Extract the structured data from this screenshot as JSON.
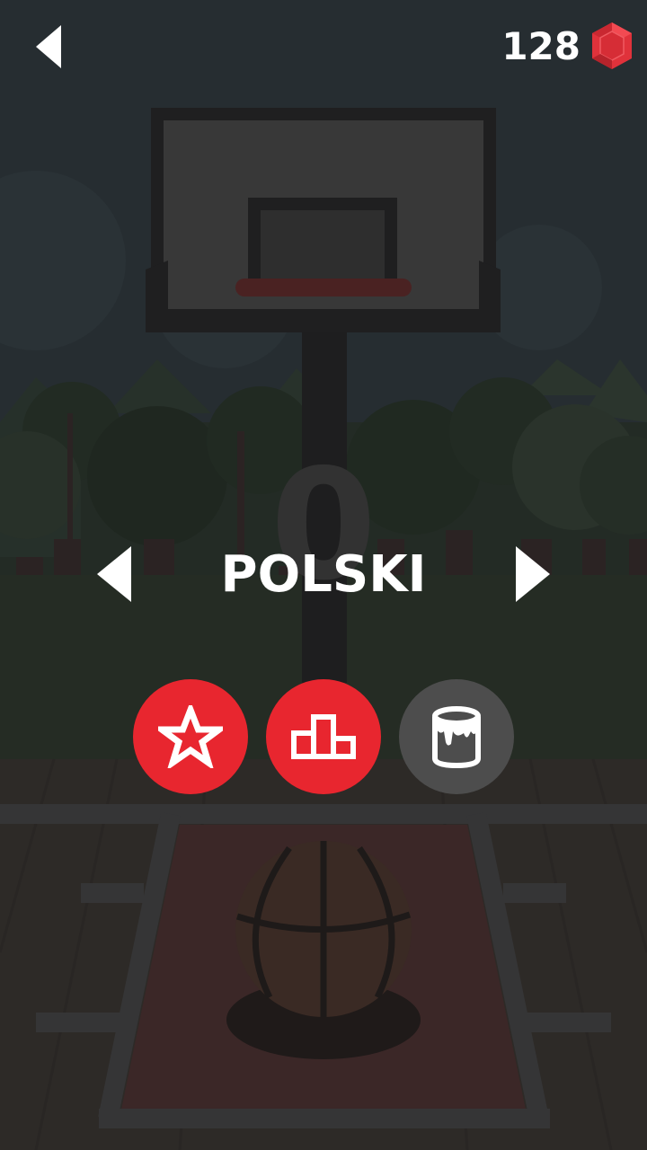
{
  "header": {
    "back_icon": "back-arrow-icon",
    "gem_count": "128",
    "gem_icon": "ruby-gem-icon",
    "gem_color": "#e0323b"
  },
  "game": {
    "score": "0",
    "team_name": "POLSKI",
    "prev_icon": "left-arrow-icon",
    "next_icon": "right-arrow-icon"
  },
  "actions": [
    {
      "name": "favorites",
      "icon": "star-icon",
      "color": "#e8262f"
    },
    {
      "name": "leaderboard",
      "icon": "podium-icon",
      "color": "#e8262f"
    },
    {
      "name": "paint",
      "icon": "paint-bucket-icon",
      "color": "#4d4d4d"
    }
  ],
  "colors": {
    "accent_red": "#e8262f",
    "overlay": "#1f2629",
    "white": "#ffffff"
  }
}
